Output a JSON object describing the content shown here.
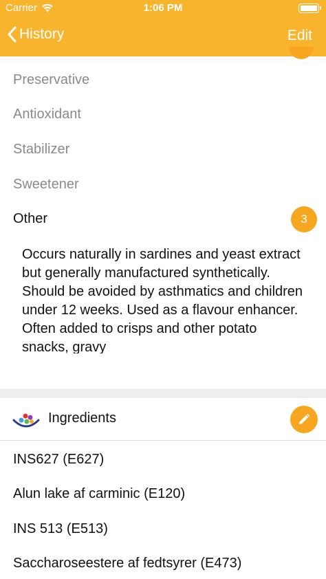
{
  "status_bar": {
    "carrier": "Carrier",
    "time": "1:06 PM"
  },
  "nav": {
    "back_label": "History",
    "edit_label": "Edit"
  },
  "categories": [
    {
      "label": "Preservative"
    },
    {
      "label": "Antioxidant"
    },
    {
      "label": "Stabilizer"
    },
    {
      "label": "Sweetener"
    },
    {
      "label": "Other",
      "count": "3"
    }
  ],
  "description": "Occurs naturally in sardines and yeast extract but generally manufactured synthetically. Should be avoided by asthmatics and children under 12 weeks. Used as a flavour enhancer. Often added to crisps and other potato snacks, gravy",
  "ingredients": {
    "title": "Ingredients",
    "items": [
      "INS627 (E627)",
      "Alun lake af carminic (E120)",
      "INS 513 (E513)",
      "Saccharoseestere af fedtsyrer (E473)"
    ]
  },
  "colors": {
    "accent": "#F8B42D",
    "badge": "#F7A71F"
  }
}
